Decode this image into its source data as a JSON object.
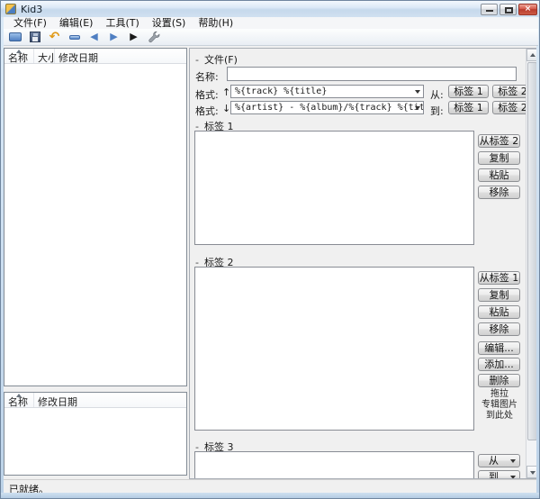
{
  "window": {
    "title": "Kid3"
  },
  "titlebar_controls": {
    "minimize": "minimize",
    "maximize": "maximize",
    "close_glyph": "×"
  },
  "menu": {
    "items": [
      "文件(F)",
      "编辑(E)",
      "工具(T)",
      "设置(S)",
      "帮助(H)"
    ]
  },
  "toolbar": {
    "icons": [
      "open",
      "save",
      "revert",
      "select-all",
      "previous-file",
      "next-file",
      "play",
      "settings"
    ],
    "revert_glyph": "↶",
    "prev_glyph": "◀",
    "next_glyph": "▶",
    "play_glyph": "▶"
  },
  "file_list_top": {
    "columns": [
      "名称",
      "大小",
      "修改日期"
    ],
    "rows": []
  },
  "file_list_bottom": {
    "columns": [
      "名称",
      "修改日期"
    ],
    "rows": []
  },
  "file_section": {
    "collapse_indicator": "-",
    "title": "文件(F)",
    "name_label": "名称:",
    "name_value": "",
    "format_label_up": "格式:",
    "up_arrow": "↑",
    "format_from_value": "%{track} %{title}",
    "from_label": "从:",
    "format_label_down": "格式:",
    "down_arrow": "↓",
    "format_to_value": "%{artist} - %{album}/%{track} %{title}",
    "to_label": "到:",
    "tag1_button": "标签 1",
    "tag2_button": "标签 2"
  },
  "tag1_section": {
    "collapse_indicator": "-",
    "title": "标签 1",
    "buttons": {
      "from_tag2": "从标签 2",
      "copy": "复制",
      "paste": "粘贴",
      "remove": "移除"
    }
  },
  "tag2_section": {
    "collapse_indicator": "-",
    "title": "标签 2",
    "buttons": {
      "from_tag1": "从标签 1",
      "copy": "复制",
      "paste": "粘贴",
      "remove": "移除",
      "edit": "编辑...",
      "add": "添加...",
      "delete": "删除"
    },
    "drop_hint": [
      "拖拉",
      "专辑图片",
      "到此处"
    ]
  },
  "tag3_section": {
    "collapse_indicator": "-",
    "title": "标签 3",
    "from_button": "从",
    "to_button": "到"
  },
  "statusbar": {
    "text": "已就绪。"
  }
}
